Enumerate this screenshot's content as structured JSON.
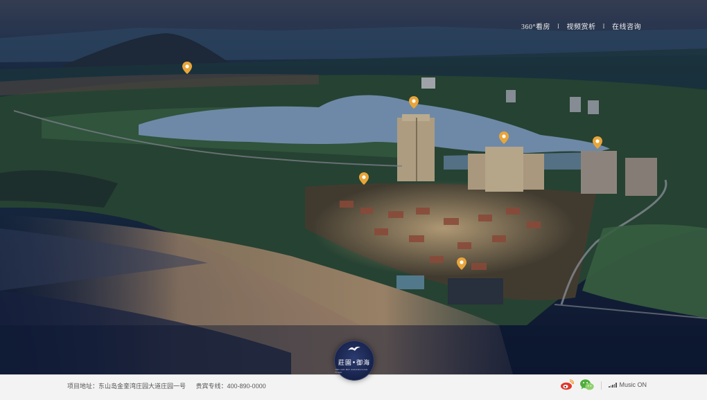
{
  "nav": {
    "items": [
      "360°看房",
      "视频赏析",
      "在线咨询"
    ],
    "separator": "I"
  },
  "brand": {
    "logo_text": "莊園•御海",
    "logo_subtext": "JINLUAN BAY ZHUANGYUAN YUHAI"
  },
  "footer": {
    "address": "项目地址：东山岛金銮湾庄园大道庄园一号",
    "hotline": "贵宾专线：400-890-0000",
    "music_label": "Music ON"
  },
  "icons": {
    "weibo": "weibo-icon",
    "wechat": "wechat-icon",
    "music": "music-bars-icon",
    "pin": "map-pin-icon"
  },
  "colors": {
    "pin": "#e8a53a",
    "footer_bg": "#f3f3f3",
    "weibo_red": "#e2362b",
    "wechat_green": "#4fae3c"
  }
}
